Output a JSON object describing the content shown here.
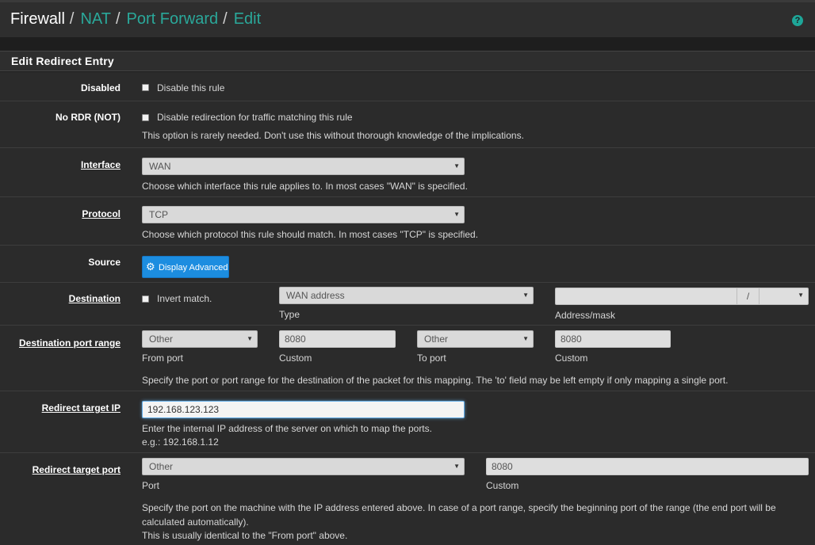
{
  "breadcrumb": {
    "first": "Firewall",
    "sep": "/",
    "items": [
      "NAT",
      "Port Forward",
      "Edit"
    ]
  },
  "help_icon": "help-icon",
  "panel_title": "Edit Redirect Entry",
  "disabled": {
    "label": "Disabled",
    "checkbox_text": "Disable this rule",
    "checked": false
  },
  "nordr": {
    "label": "No RDR (NOT)",
    "checkbox_text": "Disable redirection for traffic matching this rule",
    "help": "This option is rarely needed. Don't use this without thorough knowledge of the implications.",
    "checked": false
  },
  "interface": {
    "label": "Interface",
    "value": "WAN",
    "help": "Choose which interface this rule applies to. In most cases \"WAN\" is specified."
  },
  "protocol": {
    "label": "Protocol",
    "value": "TCP",
    "help": "Choose which protocol this rule should match. In most cases \"TCP\" is specified."
  },
  "source": {
    "label": "Source",
    "button": "Display Advanced",
    "button_icon": "gear-icon",
    "button_color": "#1c8de0"
  },
  "destination": {
    "label": "Destination",
    "invert_text": "Invert match.",
    "type_value": "WAN address",
    "type_label": "Type",
    "address_value": "",
    "mask_sep": "/",
    "mask_value": "",
    "address_label": "Address/mask"
  },
  "dest_port": {
    "label": "Destination port range",
    "from_value": "Other",
    "from_label": "From port",
    "from_custom": "8080",
    "from_custom_label": "Custom",
    "to_value": "Other",
    "to_label": "To port",
    "to_custom": "8080",
    "to_custom_label": "Custom",
    "help": "Specify the port or port range for the destination of the packet for this mapping. The 'to' field may be left empty if only mapping a single port."
  },
  "target_ip": {
    "label": "Redirect target IP",
    "value": "192.168.123.123",
    "help": "Enter the internal IP address of the server on which to map the ports.",
    "example": "e.g.: 192.168.1.12"
  },
  "target_port": {
    "label": "Redirect target port",
    "value": "Other",
    "port_label": "Port",
    "custom": "8080",
    "custom_label": "Custom",
    "help1": "Specify the port on the machine with the IP address entered above. In case of a port range, specify the beginning port of the range (the end port will be",
    "help2": "calculated automatically).",
    "help3": "This is usually identical to the \"From port\" above."
  },
  "colors": {
    "accent": "#2aa89a",
    "background": "#1e1e1e",
    "row": "#2b2b2b",
    "focus": "#66afe9"
  }
}
